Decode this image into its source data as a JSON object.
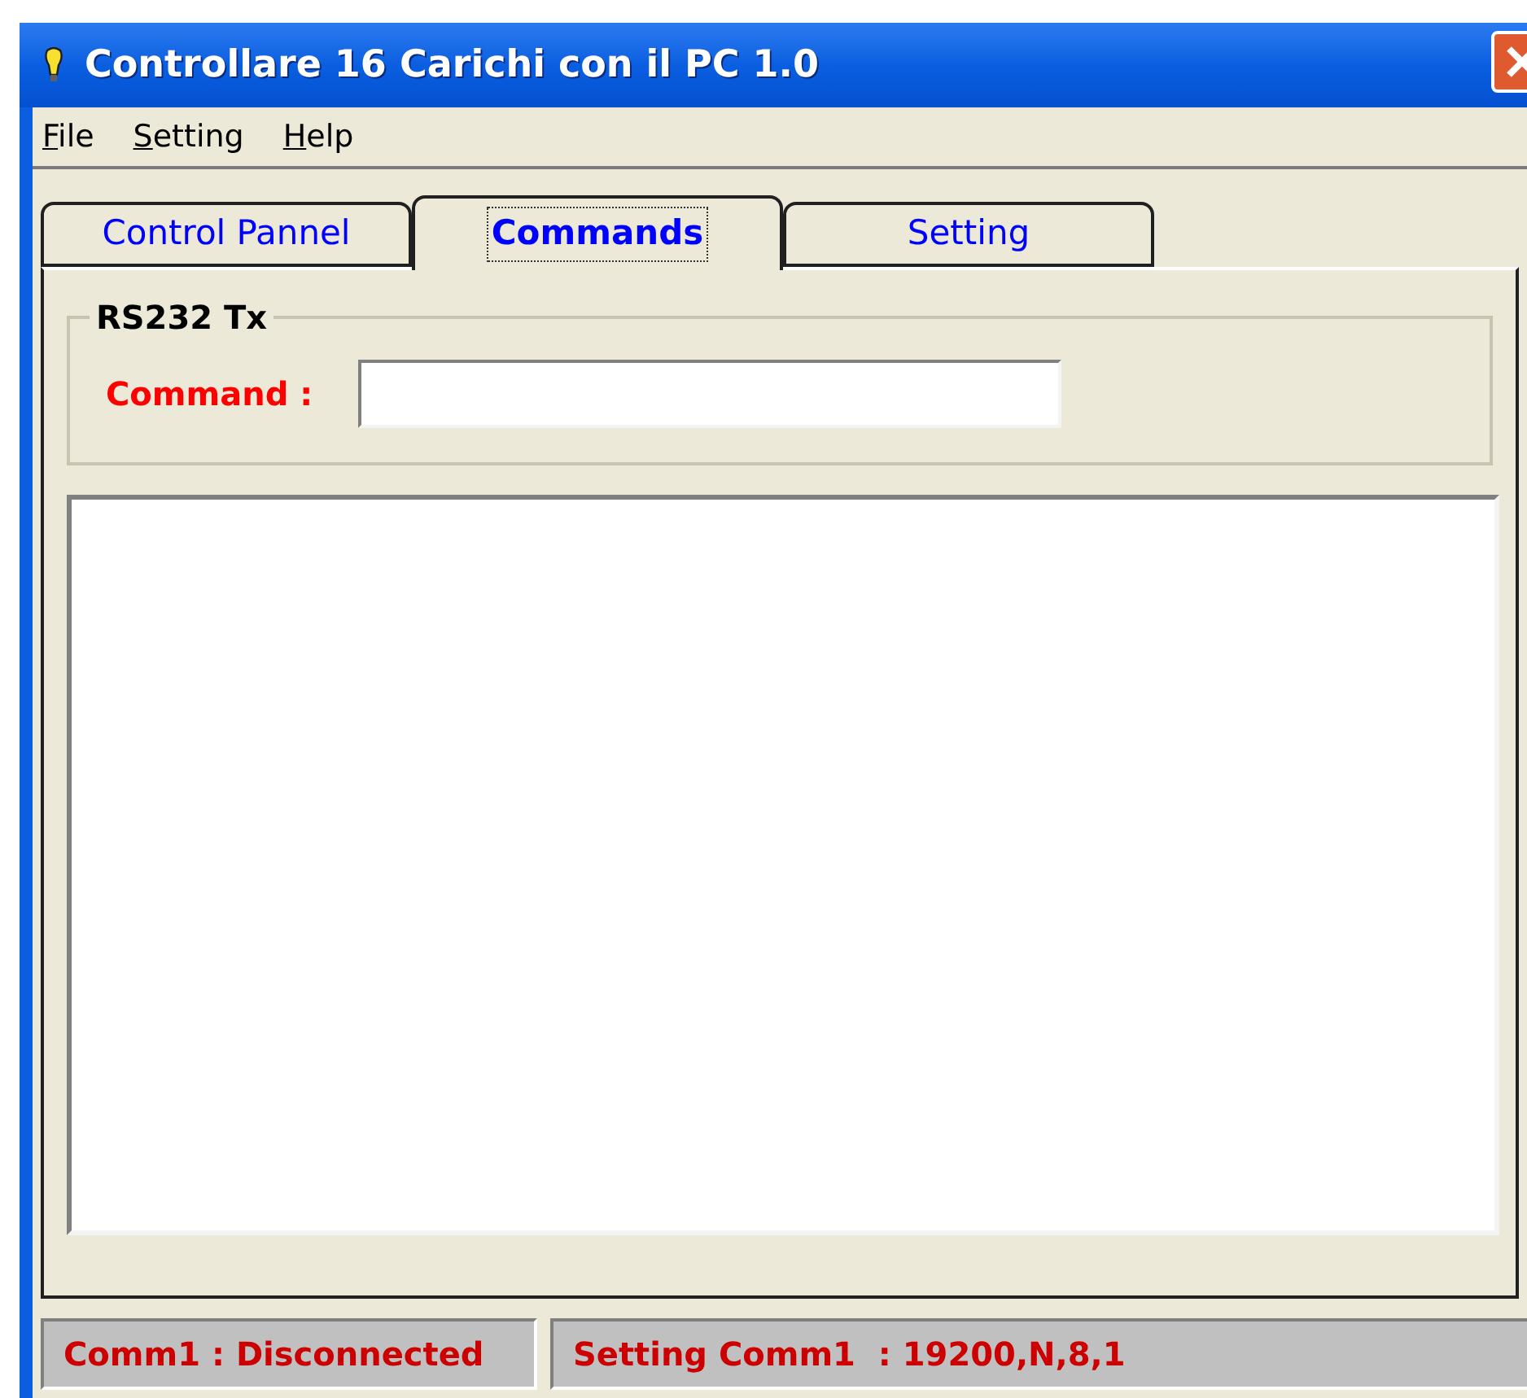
{
  "window": {
    "title": "Controllare 16 Carichi con il PC 1.0"
  },
  "menu": [
    "File",
    "Setting",
    "Help"
  ],
  "tabs": [
    {
      "label": "Control Pannel",
      "selected": false
    },
    {
      "label": "Commands",
      "selected": true
    },
    {
      "label": "Setting",
      "selected": false
    }
  ],
  "group": {
    "title": "RS232 Tx",
    "command_label": "Command :"
  },
  "status_bar": [
    "Comm1 : Disconnected",
    "Setting Comm1  : 19200,N,8,1"
  ]
}
